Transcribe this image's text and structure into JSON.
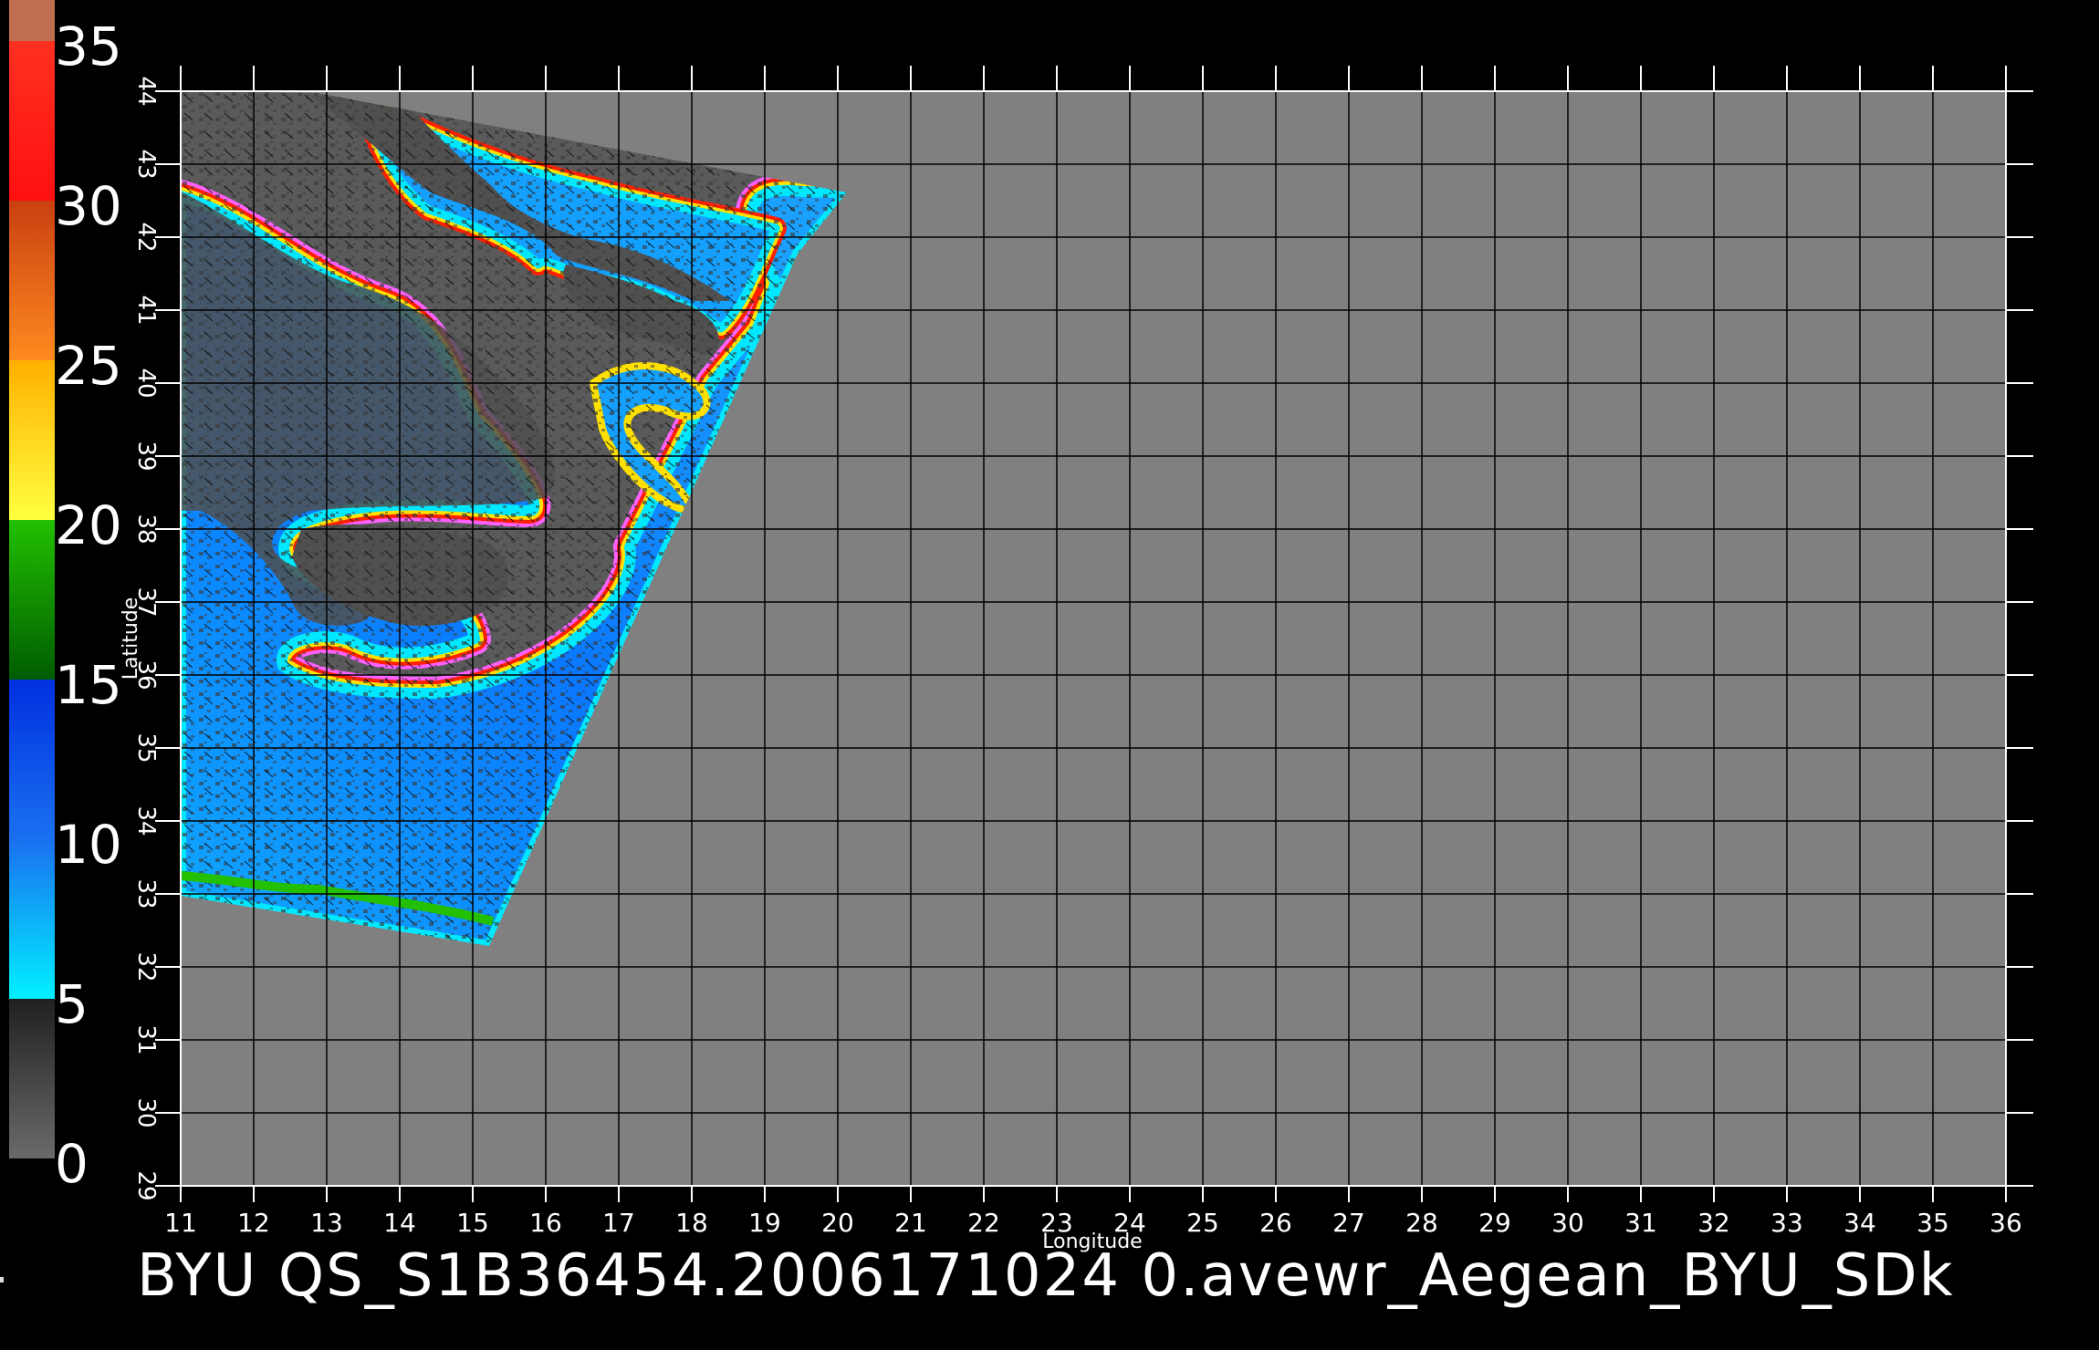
{
  "title": "BYU  QS_S1B36454.2006171024 0.avewr_Aegean_BYU_SDk",
  "axes": {
    "xlabel": "Longitude",
    "ylabel": "Latitude",
    "x_ticks": [
      "11",
      "12",
      "13",
      "14",
      "15",
      "16",
      "17",
      "18",
      "19",
      "20",
      "21",
      "22",
      "23",
      "24",
      "25",
      "26",
      "27",
      "28",
      "29",
      "30",
      "31",
      "32",
      "33",
      "34",
      "35",
      "36"
    ],
    "y_ticks": [
      "29",
      "30",
      "31",
      "32",
      "33",
      "34",
      "35",
      "36",
      "37",
      "38",
      "39",
      "40",
      "41",
      "42",
      "43",
      "44"
    ],
    "x_range": [
      11,
      36
    ],
    "y_range": [
      29,
      44
    ]
  },
  "colorbar": {
    "labels": [
      "0",
      "5",
      "10",
      "15",
      "20",
      "25",
      "30",
      "35"
    ],
    "range": [
      0,
      35
    ],
    "segments": [
      {
        "from": 0,
        "to": 5,
        "color_bottom": "#6a6a6a",
        "color_top": "#202020"
      },
      {
        "from": 5,
        "to": 10,
        "color_bottom": "#00f0ff",
        "color_top": "#1a70f0"
      },
      {
        "from": 10,
        "to": 15,
        "color_bottom": "#1a70f0",
        "color_top": "#0030e0"
      },
      {
        "from": 15,
        "to": 20,
        "color_bottom": "#005c00",
        "color_top": "#22c000"
      },
      {
        "from": 20,
        "to": 25,
        "color_bottom": "#ffff40",
        "color_top": "#ffb000"
      },
      {
        "from": 25,
        "to": 30,
        "color_bottom": "#ff8a20",
        "color_top": "#c84010"
      },
      {
        "from": 30,
        "to": 35,
        "color_bottom": "#ff1010",
        "color_top": "#ff3020"
      }
    ],
    "cap_color": "#c07050"
  },
  "colors": {
    "background": "#000000",
    "plot_background": "#808080",
    "swath_background": "#5a5a5a",
    "land": "#505050",
    "ocean_low": "#12a0ff",
    "ocean_high": "#0060ff",
    "coast_ring": [
      "#00e8ff",
      "#ffe000",
      "#ff2000",
      "#ff60ff"
    ],
    "grid": "#000000"
  }
}
